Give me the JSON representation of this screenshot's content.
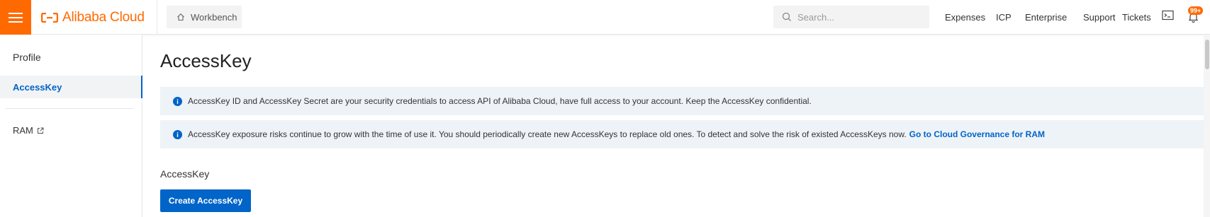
{
  "header": {
    "logo_text": "Alibaba Cloud",
    "workbench_label": "Workbench",
    "search_placeholder": "Search...",
    "nav": [
      "Expenses",
      "ICP",
      "Enterprise",
      "Support",
      "Tickets"
    ],
    "notification_badge": "99+",
    "brand_color": "#ff6a00"
  },
  "sidebar": {
    "title": "Profile",
    "active_item": "AccessKey",
    "items": [
      {
        "label": "RAM",
        "icon": "external-link-icon"
      }
    ]
  },
  "main": {
    "title": "AccessKey",
    "notices": [
      {
        "text": "AccessKey ID and AccessKey Secret are your security credentials to access API of Alibaba Cloud, have full access to your account. Keep the AccessKey confidential.",
        "link": ""
      },
      {
        "text": "AccessKey exposure risks continue to grow with the time of use it. You should periodically create new AccessKeys to replace old ones. To detect and solve the risk of existed AccessKeys now.",
        "link": "Go to Cloud Governance for RAM"
      }
    ],
    "section_title": "AccessKey",
    "create_button": "Create AccessKey",
    "accent_color": "#0064c8"
  }
}
